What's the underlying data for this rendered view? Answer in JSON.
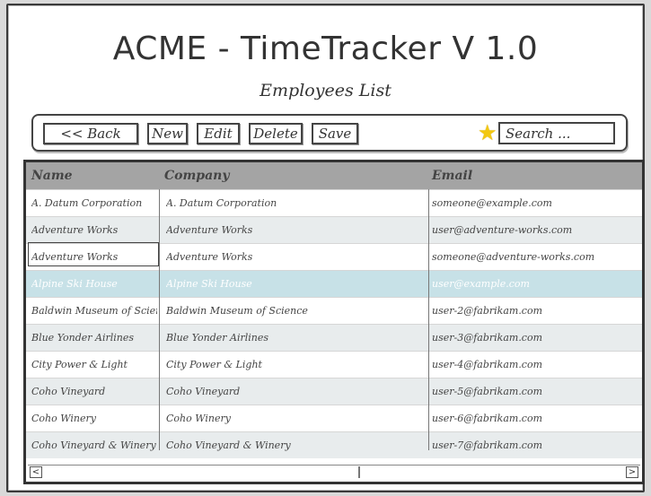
{
  "app": {
    "title": "ACME - TimeTracker V 1.0",
    "subtitle": "Employees List"
  },
  "toolbar": {
    "back_label": "<< Back",
    "new_label": "New",
    "edit_label": "Edit",
    "delete_label": "Delete",
    "save_label": "Save",
    "star_icon": "star-icon",
    "search_placeholder": "Search ..."
  },
  "table": {
    "columns": [
      "Name",
      "Company",
      "Email"
    ],
    "rows": [
      {
        "name": "A. Datum Corporation",
        "company": "A. Datum Corporation",
        "email": "someone@example.com"
      },
      {
        "name": "Adventure Works",
        "company": "Adventure Works",
        "email": "user@adventure-works.com"
      },
      {
        "name": "Adventure Works",
        "company": "Adventure Works",
        "email": "someone@adventure-works.com"
      },
      {
        "name": "Alpine Ski House",
        "company": "Alpine Ski House",
        "email": "user@example.com"
      },
      {
        "name": "Baldwin Museum of Science",
        "company": "Baldwin Museum of Science",
        "email": "user-2@fabrikam.com"
      },
      {
        "name": "Blue Yonder Airlines",
        "company": "Blue Yonder Airlines",
        "email": "user-3@fabrikam.com"
      },
      {
        "name": "City Power & Light",
        "company": "City Power & Light",
        "email": "user-4@fabrikam.com"
      },
      {
        "name": "Coho Vineyard",
        "company": "Coho Vineyard",
        "email": "user-5@fabrikam.com"
      },
      {
        "name": "Coho Winery",
        "company": "Coho Winery",
        "email": "user-6@fabrikam.com"
      },
      {
        "name": "Coho Vineyard & Winery",
        "company": "Coho Vineyard & Winery",
        "email": "user-7@fabrikam.com"
      }
    ]
  },
  "scrollbar": {
    "left_arrow": "<",
    "right_arrow": ">"
  },
  "colors": {
    "header_bg": "#a4a4a4",
    "row_alt_bg": "#e8eced",
    "row_selected_bg": "#c7e1e7",
    "star": "#f2c811"
  }
}
